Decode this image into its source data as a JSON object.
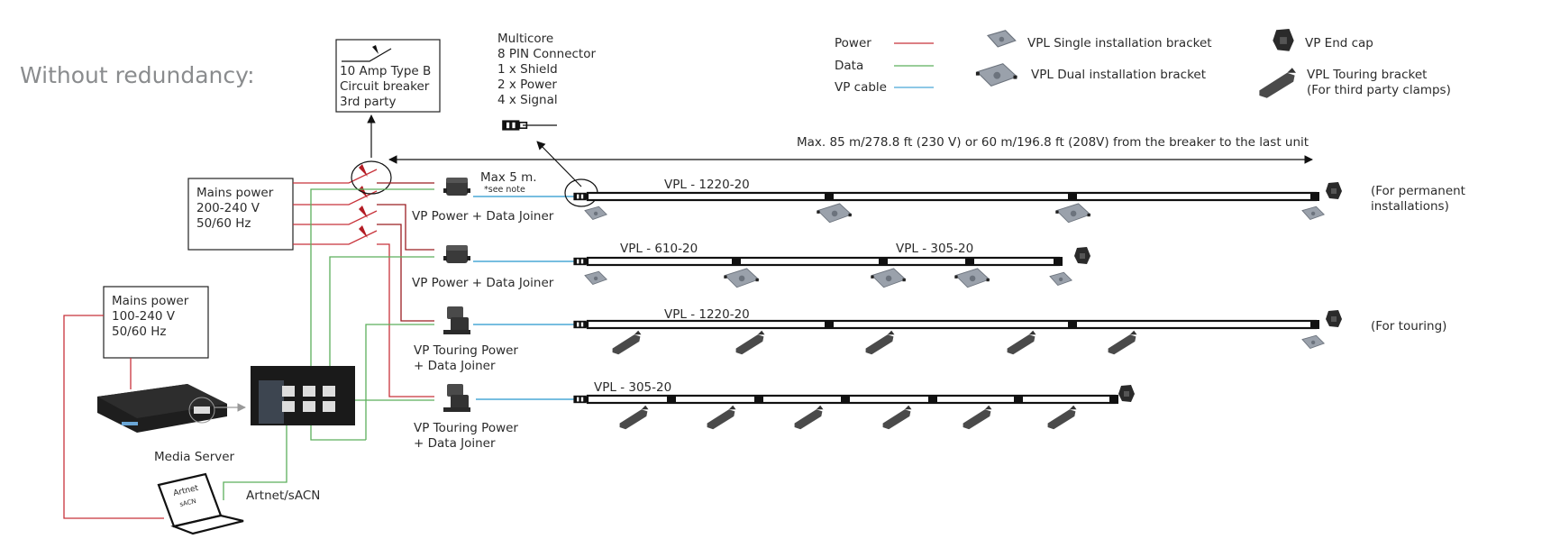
{
  "title": "Without redundancy:",
  "breaker_box": {
    "lines": [
      "10 Amp Type B",
      "Circuit breaker",
      "3rd party"
    ]
  },
  "multicore": {
    "lines": [
      "Multicore",
      "8 PIN Connector",
      "1 x Shield",
      "2 x Power",
      "4 x Signal"
    ]
  },
  "legend": {
    "lines": [
      {
        "label": "Power",
        "color": "#c8333b"
      },
      {
        "label": "Data",
        "color": "#5caf5c"
      },
      {
        "label": "VP cable",
        "color": "#4aa8d6"
      }
    ],
    "parts": [
      {
        "icon": "single-bracket-icon",
        "label": "VPL Single installation bracket"
      },
      {
        "icon": "dual-bracket-icon",
        "label": "VPL Dual installation bracket"
      },
      {
        "icon": "end-cap-icon",
        "label": "VP End cap"
      },
      {
        "icon": "touring-bracket-icon",
        "label": "VPL Touring bracket",
        "label2": "(For third party clamps)"
      }
    ]
  },
  "max_distance": "Max. 85 m/278.8 ft (230 V) or 60 m/196.8 ft (208V) from the breaker to the last unit",
  "mains_high": {
    "lines": [
      "Mains power",
      "200-240 V",
      "50/60 Hz"
    ]
  },
  "mains_low": {
    "lines": [
      "Mains power",
      "100-240 V",
      "50/60 Hz"
    ]
  },
  "max_5m": "Max 5 m.",
  "see_note": "*see note",
  "joiners": [
    {
      "label": "VP Power + Data Joiner"
    },
    {
      "label": "VP Power + Data Joiner"
    },
    {
      "label": "VP Touring Power",
      "label2": "+ Data Joiner"
    },
    {
      "label": "VP Touring Power",
      "label2": "+ Data Joiner"
    }
  ],
  "rows": [
    {
      "fixture_labels": [
        "VPL - 1220-20"
      ],
      "note": "(For permanent",
      "note2": "installations)"
    },
    {
      "fixture_labels": [
        "VPL - 610-20",
        "VPL - 305-20"
      ]
    },
    {
      "fixture_labels": [
        "VPL - 1220-20"
      ],
      "note": "(For touring)"
    },
    {
      "fixture_labels": [
        "VPL - 305-20"
      ]
    }
  ],
  "media_server": "Media Server",
  "laptop": {
    "screen1": "Artnet",
    "screen2": "sACN"
  },
  "artnet_label": "Artnet/sACN"
}
